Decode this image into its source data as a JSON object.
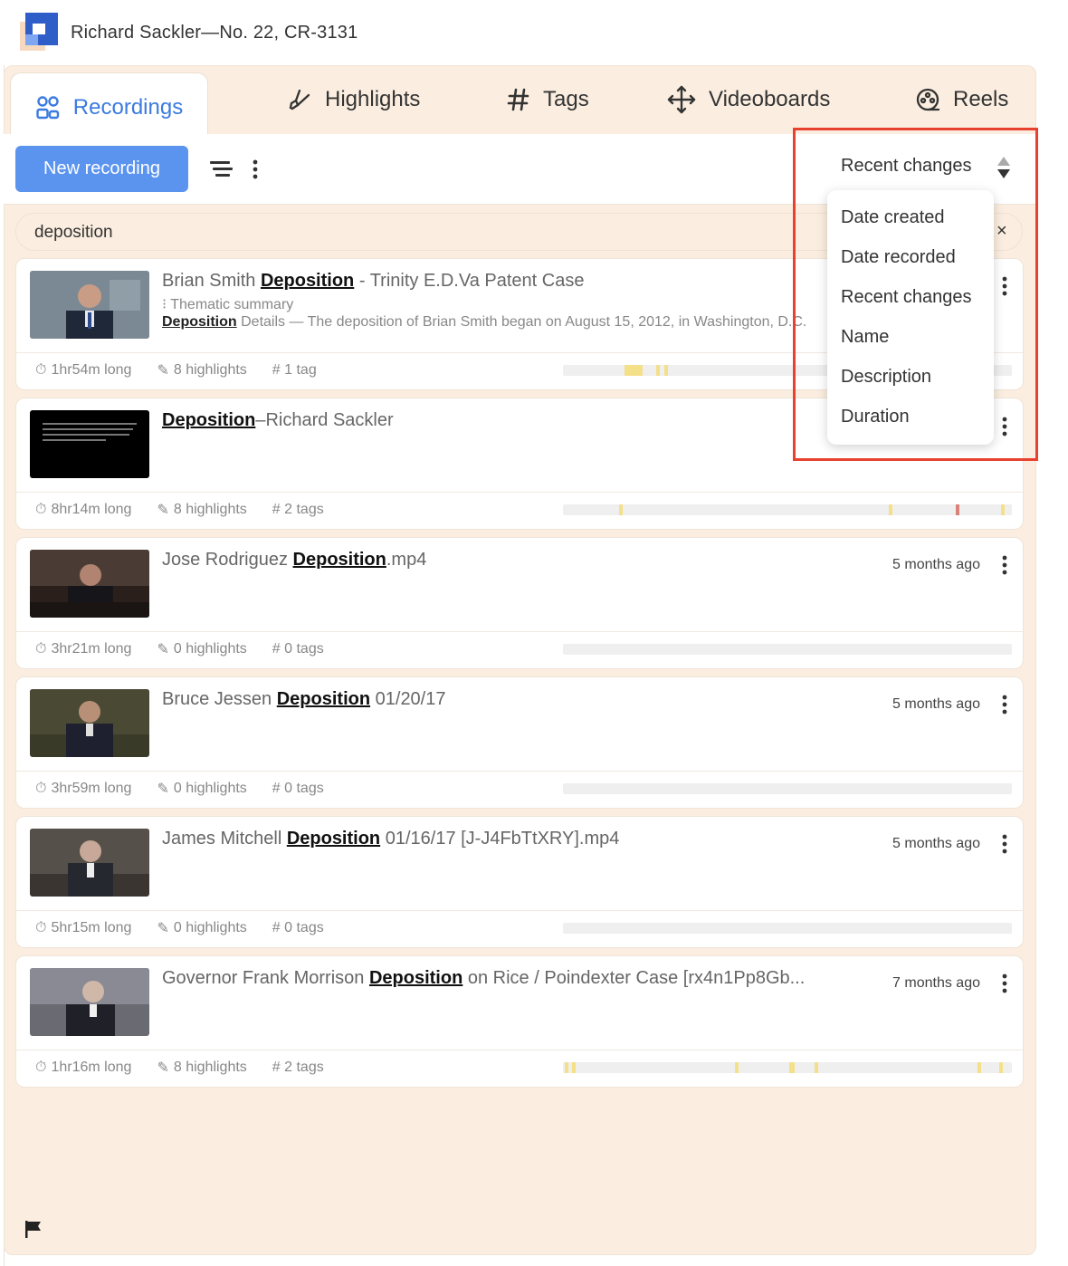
{
  "app": {
    "title": "Richard Sackler—No. 22, CR-3131"
  },
  "tabs": [
    {
      "label": "Recordings",
      "icon": "people-icon",
      "active": true
    },
    {
      "label": "Highlights",
      "icon": "highlighter-icon"
    },
    {
      "label": "Tags",
      "icon": "hash-icon"
    },
    {
      "label": "Videoboards",
      "icon": "move-icon"
    },
    {
      "label": "Reels",
      "icon": "reel-icon"
    }
  ],
  "toolbar": {
    "new_recording_label": "New recording",
    "sort_label": "Recent changes"
  },
  "search": {
    "value": "deposition",
    "clear": "×"
  },
  "sort_menu": {
    "items": [
      "Date created",
      "Date recorded",
      "Recent changes",
      "Name",
      "Description",
      "Duration"
    ]
  },
  "recordings": [
    {
      "title_pre": "Brian Smith ",
      "title_hl": "Deposition",
      "title_post": " - Trinity E.D.Va Patent Case",
      "sub": "Thematic summary",
      "desc_hl": "Deposition",
      "desc": " Details — The deposition of Brian Smith began on August 15, 2012, in Washington, D.C.",
      "age": "",
      "duration": "1hr54m long",
      "highlights": "8 highlights",
      "tags": "# 1 tag"
    },
    {
      "title_pre": "",
      "title_hl": "Deposition",
      "title_post": "–Richard Sackler",
      "age": "",
      "duration": "8hr14m long",
      "highlights": "8 highlights",
      "tags": "# 2 tags"
    },
    {
      "title_pre": "Jose Rodriguez ",
      "title_hl": "Deposition",
      "title_post": ".mp4",
      "age": "5 months ago",
      "duration": "3hr21m long",
      "highlights": "0 highlights",
      "tags": "# 0 tags"
    },
    {
      "title_pre": "Bruce Jessen ",
      "title_hl": "Deposition",
      "title_post": " 01/20/17",
      "age": "5 months ago",
      "duration": "3hr59m long",
      "highlights": "0 highlights",
      "tags": "# 0 tags"
    },
    {
      "title_pre": "James Mitchell ",
      "title_hl": "Deposition",
      "title_post": " 01/16/17 [J-J4FbTtXRY].mp4",
      "age": "5 months ago",
      "duration": "5hr15m long",
      "highlights": "0 highlights",
      "tags": "# 0 tags"
    },
    {
      "title_pre": "Governor Frank Morrison ",
      "title_hl": "Deposition",
      "title_post": " on Rice / Poindexter Case [rx4n1Pp8Gb...",
      "age": "7 months ago",
      "duration": "1hr16m long",
      "highlights": "8 highlights",
      "tags": "# 2 tags"
    }
  ],
  "colors": {
    "accent": "#5b94ef",
    "panel": "#fbeee0",
    "highlight_box": "#e8412f",
    "mark_yellow": "#f5e08a",
    "mark_red": "#d9827a"
  }
}
